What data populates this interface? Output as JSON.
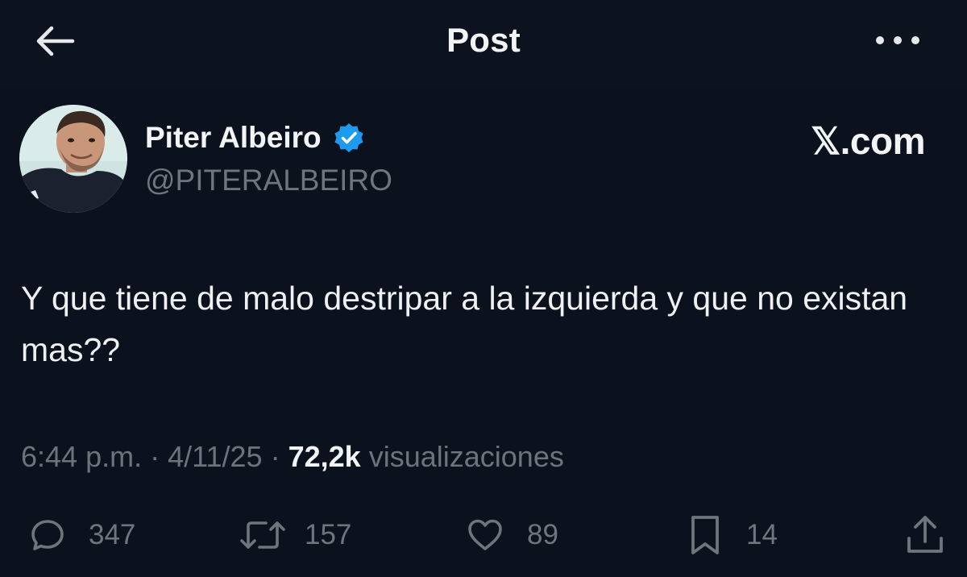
{
  "header": {
    "title": "Post",
    "back_icon": "arrow-left-icon",
    "more_icon": "more-horizontal-icon"
  },
  "author": {
    "name": "Piter Albeiro",
    "handle": "@PITERALBEIRO",
    "verified": true,
    "verified_color": "#1d9bf0"
  },
  "brand": "𝕏.com",
  "tweet": {
    "text": "Y que tiene de malo destripar a la izquierda y que no existan mas??"
  },
  "meta": {
    "time": "6:44 p.m.",
    "separator": "·",
    "date": "4/11/25",
    "views_count": "72,2k",
    "views_label": "visualizaciones"
  },
  "actions": {
    "replies": "347",
    "reposts": "157",
    "likes": "89",
    "bookmarks": "14"
  },
  "colors": {
    "background": "#0b121d",
    "text_primary": "#e7e9ea",
    "text_secondary": "#6e767d"
  }
}
